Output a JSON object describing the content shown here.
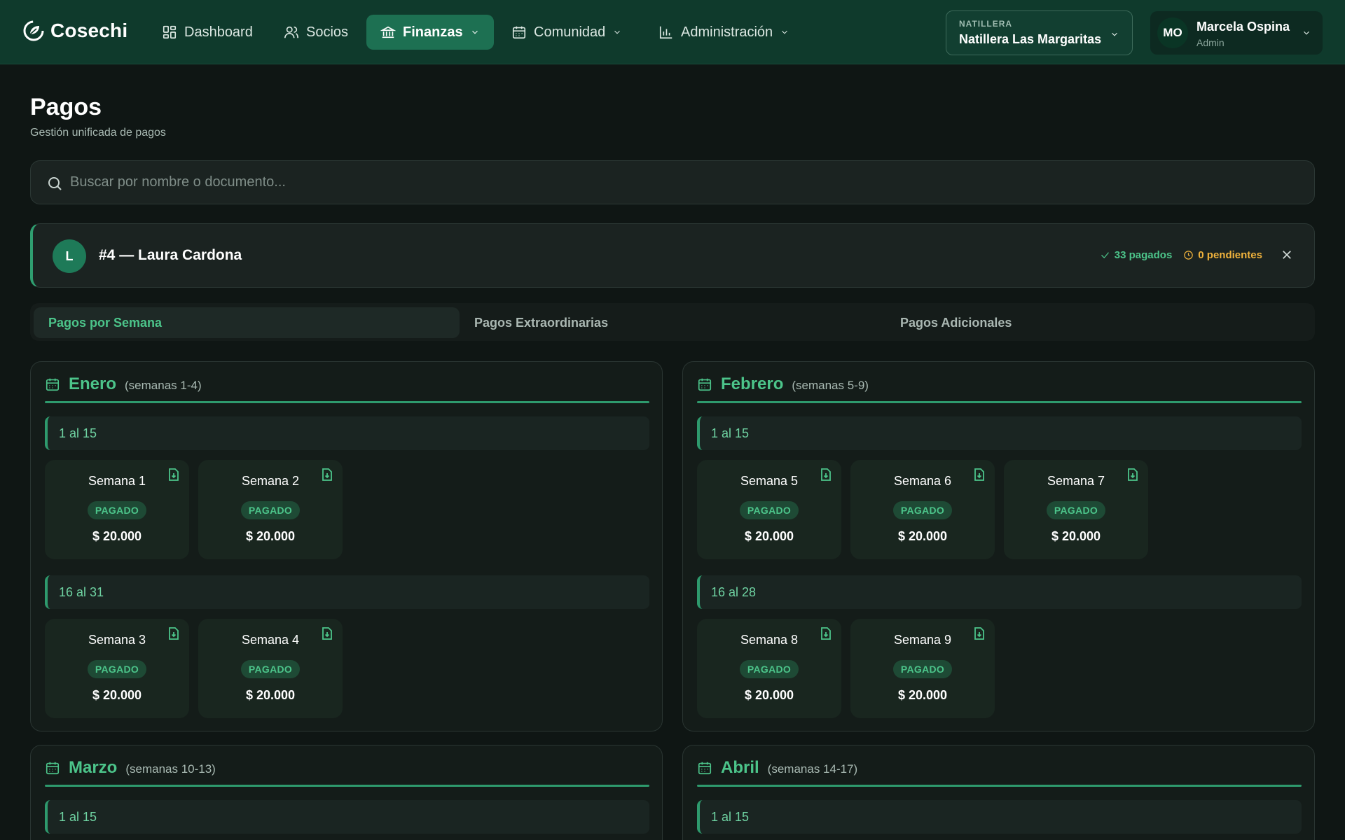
{
  "app": {
    "name": "Cosechi"
  },
  "nav": {
    "dashboard": "Dashboard",
    "socios": "Socios",
    "finanzas": "Finanzas",
    "comunidad": "Comunidad",
    "administracion": "Administración"
  },
  "org": {
    "label": "NATILLERA",
    "name": "Natillera Las Margaritas"
  },
  "user": {
    "initials": "MO",
    "name": "Marcela Ospina",
    "role": "Admin"
  },
  "page": {
    "title": "Pagos",
    "subtitle": "Gestión unificada de pagos"
  },
  "search": {
    "placeholder": "Buscar por nombre o documento..."
  },
  "member": {
    "initial": "L",
    "name": "#4 — Laura Cardona",
    "paid": "33 pagados",
    "pending": "0 pendientes"
  },
  "tabs": {
    "weekly": "Pagos por Semana",
    "extra": "Pagos Extraordinarias",
    "additional": "Pagos Adicionales"
  },
  "months": [
    {
      "name": "Enero",
      "range": "(semanas 1-4)",
      "periods": [
        {
          "label": "1 al 15",
          "weeks": [
            {
              "title": "Semana 1",
              "status": "PAGADO",
              "amount": "$ 20.000"
            },
            {
              "title": "Semana 2",
              "status": "PAGADO",
              "amount": "$ 20.000"
            }
          ]
        },
        {
          "label": "16 al 31",
          "weeks": [
            {
              "title": "Semana 3",
              "status": "PAGADO",
              "amount": "$ 20.000"
            },
            {
              "title": "Semana 4",
              "status": "PAGADO",
              "amount": "$ 20.000"
            }
          ]
        }
      ]
    },
    {
      "name": "Febrero",
      "range": "(semanas 5-9)",
      "periods": [
        {
          "label": "1 al 15",
          "weeks": [
            {
              "title": "Semana 5",
              "status": "PAGADO",
              "amount": "$ 20.000"
            },
            {
              "title": "Semana 6",
              "status": "PAGADO",
              "amount": "$ 20.000"
            },
            {
              "title": "Semana 7",
              "status": "PAGADO",
              "amount": "$ 20.000"
            }
          ]
        },
        {
          "label": "16 al 28",
          "weeks": [
            {
              "title": "Semana 8",
              "status": "PAGADO",
              "amount": "$ 20.000"
            },
            {
              "title": "Semana 9",
              "status": "PAGADO",
              "amount": "$ 20.000"
            }
          ]
        }
      ]
    },
    {
      "name": "Marzo",
      "range": "(semanas 10-13)",
      "periods": [
        {
          "label": "1 al 15",
          "weeks": []
        }
      ]
    },
    {
      "name": "Abril",
      "range": "(semanas 14-17)",
      "periods": [
        {
          "label": "1 al 15",
          "weeks": []
        }
      ]
    }
  ],
  "colors": {
    "nav_bg": "#0f3a2c",
    "accent": "#4cc48a",
    "active_nav": "#1d7052",
    "pending": "#f0b23c",
    "page_bg": "#0f1614"
  },
  "icons": {
    "logo": "leaf-spiral-icon",
    "dashboard": "grid-icon",
    "socios": "users-icon",
    "finanzas": "bank-icon",
    "comunidad": "calendar-icon",
    "administracion": "bar-chart-icon",
    "search": "search-icon",
    "paid": "check-icon",
    "pending": "clock-icon",
    "close": "close-icon",
    "month": "calendar-icon",
    "receipt": "file-download-icon"
  }
}
